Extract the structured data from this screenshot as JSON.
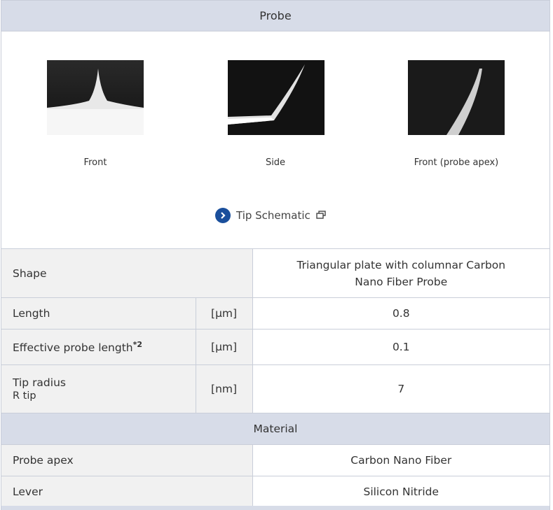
{
  "header": {
    "title": "Probe"
  },
  "images": [
    {
      "label": "Front"
    },
    {
      "label": "Side"
    },
    {
      "label": "Front (probe apex)"
    }
  ],
  "schematic_link": {
    "label": "Tip Schematic",
    "icon": "chevron-right-icon",
    "external_icon": "new-window-icon"
  },
  "specs": {
    "shape": {
      "label": "Shape",
      "value": "Triangular plate with columnar Carbon Nano Fiber Probe"
    },
    "length": {
      "label": "Length",
      "unit": "[μm]",
      "value": "0.8"
    },
    "effective": {
      "label": "Effective probe length",
      "note": "*2",
      "unit": "[μm]",
      "value": "0.1"
    },
    "tip_radius": {
      "label": "Tip radius",
      "sublabel": "R tip",
      "unit": "[nm]",
      "value": "7"
    }
  },
  "material": {
    "title": "Material",
    "probe_apex": {
      "label": "Probe apex",
      "value": "Carbon Nano Fiber"
    },
    "lever": {
      "label": "Lever",
      "value": "Silicon Nitride"
    }
  },
  "colors": {
    "header_bg": "#d7dce8",
    "label_bg": "#f1f1f1",
    "accent": "#1a4f9c"
  }
}
